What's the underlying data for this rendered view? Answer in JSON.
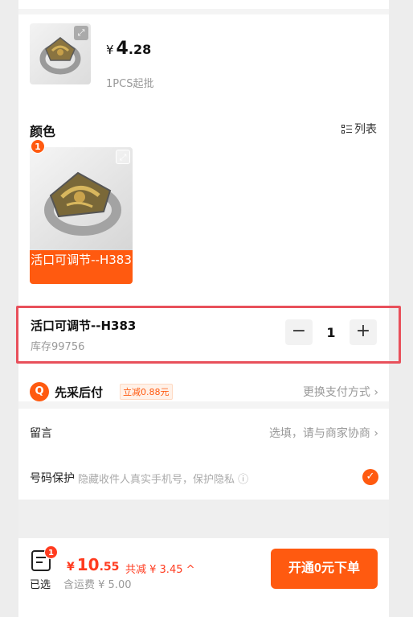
{
  "product": {
    "currency": "¥",
    "price_int": "4",
    "price_dec": ".28",
    "moq": "1PCS起批"
  },
  "color_section": {
    "title": "颜色",
    "list_toggle_label": "列表",
    "variants": [
      {
        "label": "活口可调节--H383",
        "selected_count": "1"
      }
    ]
  },
  "sku": {
    "name": "活口可调节--H383",
    "stock": "库存99756",
    "quantity": "1",
    "minus": "−",
    "plus": "+"
  },
  "payment": {
    "title": "先采后付",
    "tag": "立减0.88元",
    "change": "更换支付方式 ›"
  },
  "message": {
    "label": "留言",
    "hint": "选填，请与商家协商 ›"
  },
  "phone_protect": {
    "label": "号码保护",
    "desc": "隐藏收件人真实手机号，保护隐私 ⓘ",
    "checked": true
  },
  "bottom_bar": {
    "cart_count": "1",
    "selected_label": "已选",
    "currency": "¥",
    "total_int": "10",
    "total_dec": ".55",
    "discount": "共减 ¥ 3.45 ^",
    "shipping": "含运费 ¥ 5.00",
    "submit_label": "开通0元下单"
  },
  "colors": {
    "accent": "#ff5a10",
    "price_red": "#ff3b1f",
    "highlight_border": "#e8505b"
  }
}
